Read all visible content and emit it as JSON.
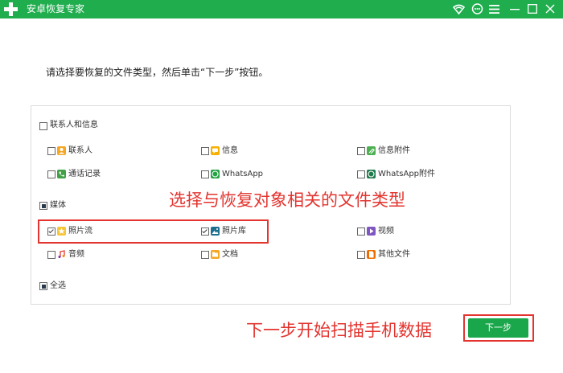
{
  "window": {
    "title": "安卓恢复专家",
    "header_icons": [
      "wifi-icon",
      "chat-icon",
      "menu-icon",
      "minimize-icon",
      "maximize-icon",
      "close-icon"
    ]
  },
  "instruction": "请选择要恢复的文件类型，然后单击“下一步”按钮。",
  "groups": {
    "contacts": {
      "label": "联系人和信息",
      "items": {
        "contacts": "联系人",
        "messages": "信息",
        "message_attachments": "信息附件",
        "call_log": "通话记录",
        "whatsapp": "WhatsApp",
        "whatsapp_attachments": "WhatsApp附件"
      }
    },
    "media": {
      "label": "媒体",
      "items": {
        "photo_stream": "照片流",
        "photo_library": "照片库",
        "video": "视频",
        "audio": "音频",
        "documents": "文档",
        "other_files": "其他文件"
      }
    },
    "select_all": "全选"
  },
  "annotations": {
    "select_types": "选择与恢复对象相关的文件类型",
    "next_scan": "下一步开始扫描手机数据"
  },
  "next_button": "下一步",
  "colors": {
    "brand_green": "#1fad4e",
    "annotation_red": "#e3342f"
  }
}
